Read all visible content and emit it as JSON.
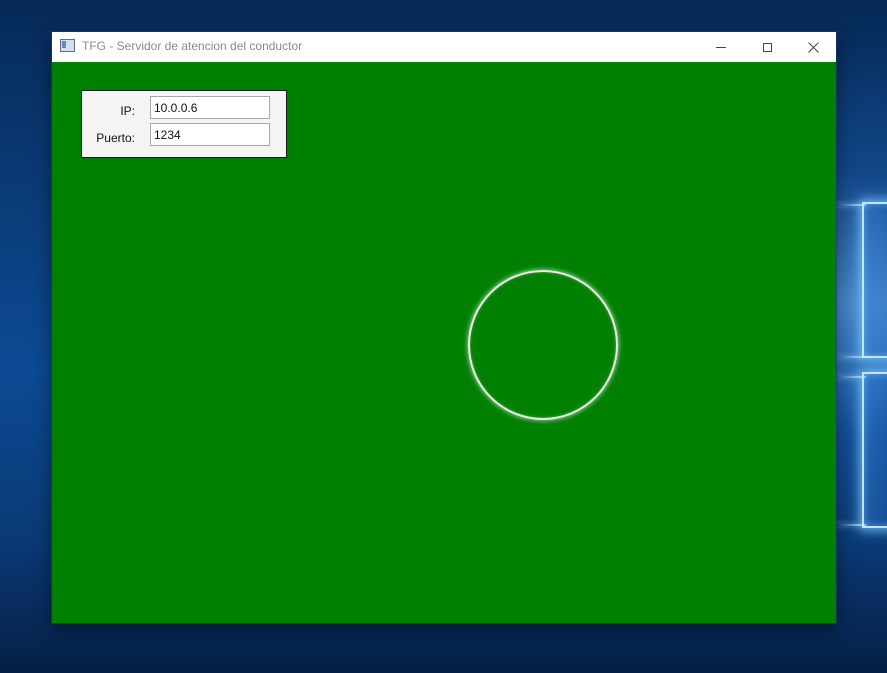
{
  "window": {
    "title": "TFG - Servidor de atencion del conductor"
  },
  "colors": {
    "client_background": "#008000",
    "circle_outline": "#e8f0e8"
  },
  "icons": {
    "app": "app-window-icon",
    "minimize": "minimize-icon",
    "maximize": "maximize-icon",
    "close": "close-icon"
  },
  "connection": {
    "ip_label": "IP:",
    "ip_value": "10.0.0.6",
    "port_label": "Puerto:",
    "port_value": "1234"
  }
}
